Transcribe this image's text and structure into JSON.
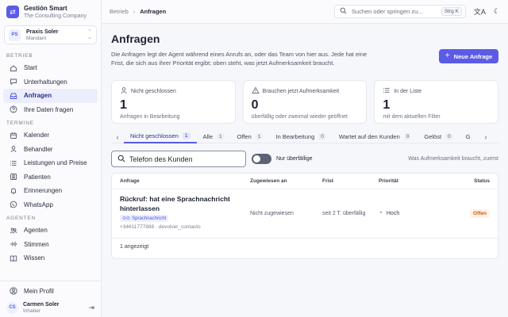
{
  "brand": {
    "logo_icon": "arrow-left-right-icon",
    "name": "Gestión Smart",
    "company": "The Consulting Company"
  },
  "practice": {
    "initials": "PS",
    "name": "Praxis Soler",
    "role": "Mandant"
  },
  "sidebar": {
    "sections": [
      {
        "title": "BETRIEB",
        "items": [
          {
            "label": "Start",
            "icon": "home-icon"
          },
          {
            "label": "Unterhaltungen",
            "icon": "chat-icon"
          },
          {
            "label": "Anfragen",
            "icon": "tray-icon",
            "active": true
          },
          {
            "label": "Ihre Daten fragen",
            "icon": "question-icon"
          }
        ]
      },
      {
        "title": "TERMINE",
        "items": [
          {
            "label": "Kalender",
            "icon": "calendar-icon"
          },
          {
            "label": "Behandler",
            "icon": "user-icon"
          },
          {
            "label": "Leistungen und Preise",
            "icon": "list-icon"
          },
          {
            "label": "Patienten",
            "icon": "contacts-icon"
          },
          {
            "label": "Erinnerungen",
            "icon": "bell-icon"
          },
          {
            "label": "WhatsApp",
            "icon": "whatsapp-icon"
          }
        ]
      },
      {
        "title": "AGENTEN",
        "items": [
          {
            "label": "Agenten",
            "icon": "agents-icon"
          },
          {
            "label": "Stimmen",
            "icon": "voice-icon"
          },
          {
            "label": "Wissen",
            "icon": "book-icon"
          }
        ]
      }
    ]
  },
  "footer": {
    "profile_label": "Mein Profil",
    "user_initials": "CS",
    "user_name": "Carmen Soler",
    "user_role": "Inhaber"
  },
  "topbar": {
    "breadcrumb_parent": "Betrieb",
    "breadcrumb_current": "Anfragen",
    "search_placeholder": "Suchen oder springen zu...",
    "search_shortcut": "Strg K"
  },
  "page": {
    "title": "Anfragen",
    "description": "Die Anfragen legt der Agent während eines Anrufs an, oder das Team von hier aus. Jede hat eine Frist, die sich aus ihrer Priorität ergibt; oben steht, was jetzt Aufmerksamkeit braucht.",
    "new_button": "Neue Anfrage"
  },
  "cards": [
    {
      "label": "Nicht geschlossen",
      "icon": "user-icon",
      "value": "1",
      "sub": "Anfragen in Bearbeitung"
    },
    {
      "label": "Brauchen jetzt Aufmerksamkeit",
      "icon": "warning-icon",
      "value": "0",
      "sub": "überfällig oder zweimal wieder geöffnet"
    },
    {
      "label": "In der Liste",
      "icon": "list-icon",
      "value": "1",
      "sub": "mit dem aktuellen Filter"
    }
  ],
  "tabs": [
    {
      "label": "Nicht geschlossen",
      "count": "1",
      "active": true
    },
    {
      "label": "Alle",
      "count": "1"
    },
    {
      "label": "Offen",
      "count": "1"
    },
    {
      "label": "In Bearbeitung",
      "count": "0"
    },
    {
      "label": "Wartet auf den Kunden",
      "count": "0"
    },
    {
      "label": "Gelöst",
      "count": "0"
    },
    {
      "label": "G",
      "count": ""
    }
  ],
  "filters": {
    "search_placeholder": "Telefon des Kunden",
    "toggle_label": "Nur überfällige",
    "sort_label": "Was Aufmerksamkeit braucht, zuerst",
    "toggle_on": false
  },
  "table": {
    "headers": {
      "request": "Anfrage",
      "assigned": "Zugewiesen an",
      "deadline": "Frist",
      "priority": "Priorität",
      "status": "Status"
    },
    "rows": [
      {
        "title": "Rückruf: hat eine Sprachnachricht hinterlassen",
        "tag": "Sprachnachricht",
        "meta": "+34611777888 · devolver_contacto",
        "assigned": "Nicht zugewiesen",
        "deadline": "seit 2 T. überfällig",
        "priority": "Hoch",
        "status": "Offen"
      }
    ],
    "footer": "1 angezeigt"
  }
}
